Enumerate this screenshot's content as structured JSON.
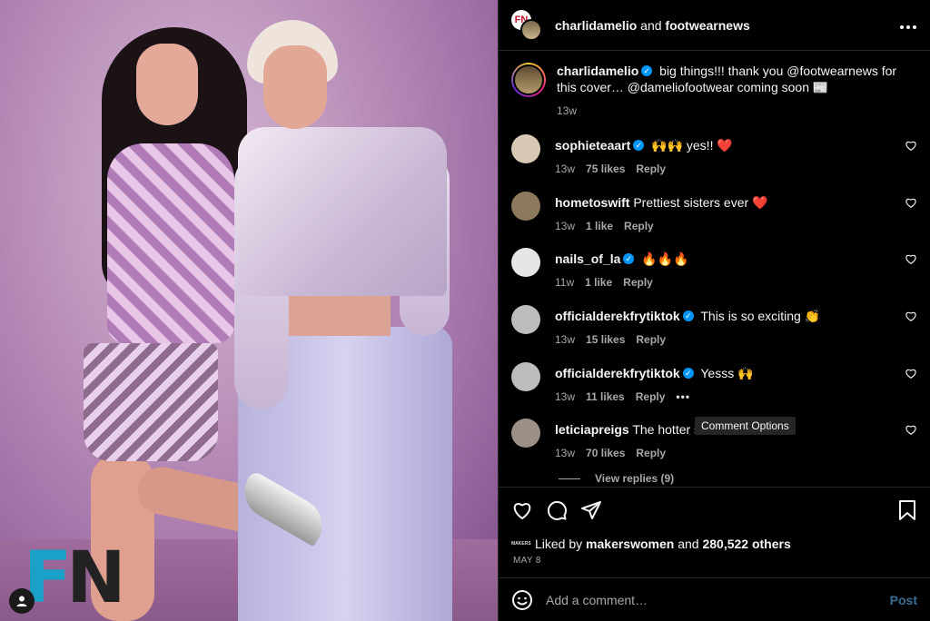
{
  "photo": {
    "logo_f": "F",
    "logo_n": "N",
    "user_tag_icon": "person-icon"
  },
  "header": {
    "user1": "charlidamelio",
    "and_text": " and ",
    "user2": "footwearnews",
    "avatar1_text": "FN",
    "more_icon": "more-horizontal-icon"
  },
  "caption": {
    "username": "charlidamelio",
    "text": "big things!!! thank you @footwearnews for this cover… @dameliofootwear coming soon 📰",
    "time": "13w"
  },
  "comments": [
    {
      "username": "sophieteaart",
      "verified": true,
      "text": "🙌🙌 yes!! ❤️",
      "time": "13w",
      "likes": "75 likes",
      "reply": "Reply",
      "avatar_color": "#d8c9b6"
    },
    {
      "username": "hometoswift",
      "verified": false,
      "text": "Prettiest sisters ever ❤️",
      "time": "13w",
      "likes": "1 like",
      "reply": "Reply",
      "avatar_color": "#8c7a5e"
    },
    {
      "username": "nails_of_la",
      "verified": true,
      "text": "🔥🔥🔥",
      "time": "11w",
      "likes": "1 like",
      "reply": "Reply",
      "avatar_color": "#e6e6e6"
    },
    {
      "username": "officialderekfrytiktok",
      "verified": true,
      "text": "This is so exciting 👏",
      "time": "13w",
      "likes": "15 likes",
      "reply": "Reply",
      "avatar_color": "#bdbdbd"
    },
    {
      "username": "officialderekfrytiktok",
      "verified": true,
      "text": "Yesss 🙌",
      "time": "13w",
      "likes": "11 likes",
      "reply": "Reply",
      "avatar_color": "#bdbdbd",
      "more": "•••"
    },
    {
      "username": "leticiapreigs",
      "verified": false,
      "text": "The hotter s",
      "time": "13w",
      "likes": "70 likes",
      "reply": "Reply",
      "avatar_color": "#9c8f86"
    }
  ],
  "tooltip": "Comment Options",
  "view_replies": "View replies (9)",
  "actions": {
    "like_icon": "heart-icon",
    "comment_icon": "comment-icon",
    "share_icon": "send-icon",
    "save_icon": "bookmark-icon"
  },
  "likes": {
    "mini_label": "MAKERS",
    "prefix": "Liked by ",
    "user": "makerswomen",
    "middle": " and ",
    "count": "280,522 others"
  },
  "date": "MAY 8",
  "add_comment": {
    "placeholder": "Add a comment…",
    "post_label": "Post",
    "emoji_icon": "smiley-icon"
  },
  "colors": {
    "verified": "#0095f6",
    "post_button": "#3a6e94",
    "fn_blue": "#1aa1c8"
  }
}
